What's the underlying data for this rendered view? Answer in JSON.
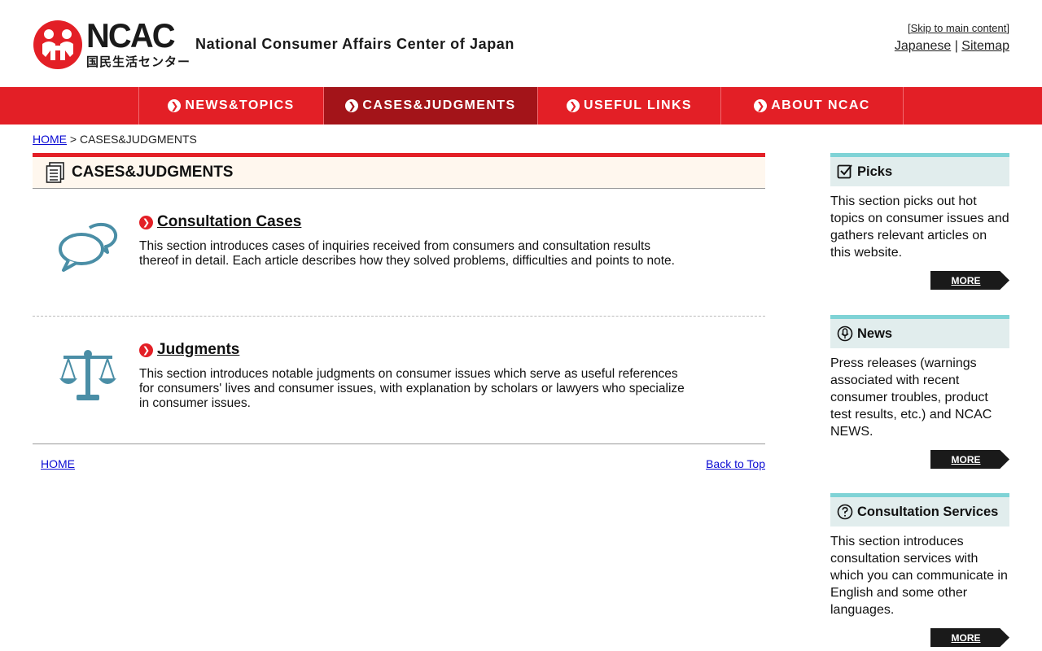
{
  "header": {
    "logo_text": "NCAC",
    "logo_subtext": "国民生活センター",
    "org_name": "National Consumer Affairs Center of Japan",
    "skip_link": "Skip to main content",
    "lang_link": "Japanese",
    "separator": "|",
    "sitemap_link": "Sitemap"
  },
  "nav": {
    "items": [
      {
        "label": "NEWS&TOPICS",
        "active": false
      },
      {
        "label": "CASES&JUDGMENTS",
        "active": true
      },
      {
        "label": "USEFUL LINKS",
        "active": false
      },
      {
        "label": "ABOUT NCAC",
        "active": false
      }
    ]
  },
  "breadcrumb": {
    "home": "HOME",
    "separator": ">",
    "current": "CASES&JUDGMENTS"
  },
  "main": {
    "title": "CASES&JUDGMENTS",
    "entries": [
      {
        "icon": "speech-bubbles-icon",
        "title": "Consultation Cases",
        "description": "This section introduces cases of inquiries received from consumers and consultation results thereof in detail. Each article describes how they solved problems, difficulties and points to note."
      },
      {
        "icon": "scales-icon",
        "title": "Judgments",
        "description": "This section introduces notable judgments on consumer issues which serve as useful references for consumers' lives and consumer issues, with explanation by scholars or lawyers who specialize in consumer issues."
      }
    ],
    "footer_home": "HOME",
    "back_to_top": "Back to Top"
  },
  "sidebar": {
    "boxes": [
      {
        "icon": "checkbox-icon",
        "title": "Picks",
        "text": "This section picks out hot topics on consumer issues and gathers relevant articles on this website.",
        "more": "MORE"
      },
      {
        "icon": "microphone-icon",
        "title": "News",
        "text": "Press releases (warnings associated with recent consumer troubles, product test results, etc.) and NCAC NEWS.",
        "more": "MORE"
      },
      {
        "icon": "question-icon",
        "title": "Consultation Services",
        "text": "This section introduces consultation services with which you can communicate in English and some other languages.",
        "more": "MORE"
      }
    ]
  },
  "colors": {
    "brand_red": "#e31f26",
    "nav_active": "#a31419",
    "sidebar_accent": "#7fd3d6",
    "icon_teal": "#4a8ea6"
  }
}
